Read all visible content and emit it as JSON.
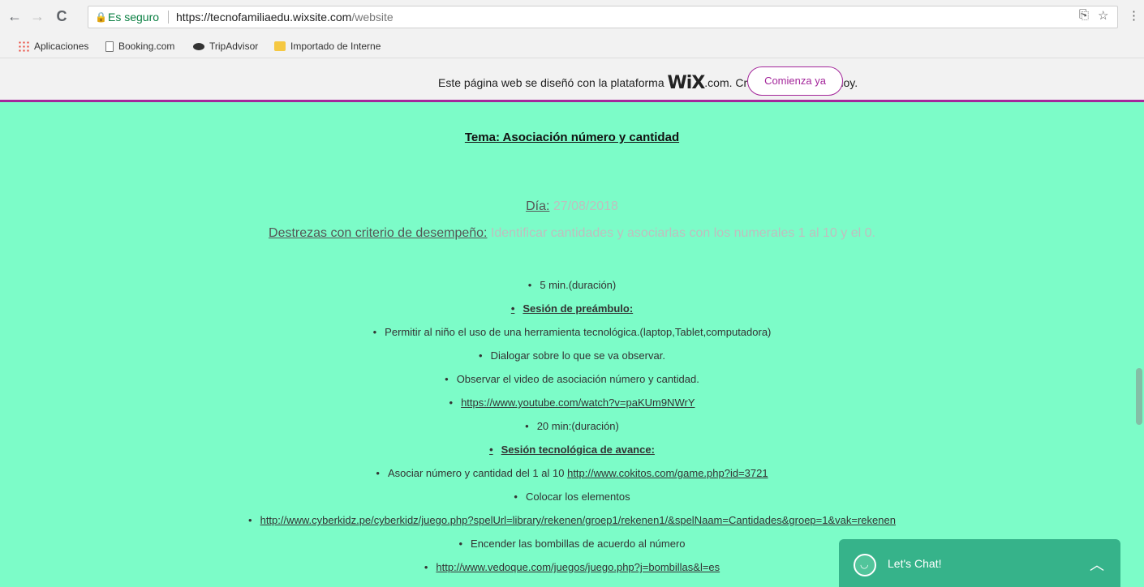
{
  "browser": {
    "back_icon": "←",
    "forward_icon": "→",
    "reload_icon": "C",
    "secure_label": "Es seguro",
    "url_host": "https://tecnofamiliaedu.wixsite.com",
    "url_path": "/website",
    "translate_icon": "⎘",
    "star_icon": "☆",
    "menu_icon": "⋮"
  },
  "bookmarks": [
    {
      "label": "Aplicaciones",
      "icon": "apps-icon"
    },
    {
      "label": "Booking.com",
      "icon": "page-icon"
    },
    {
      "label": "TripAdvisor",
      "icon": "tripadvisor-icon"
    },
    {
      "label": "Importado de Interne",
      "icon": "folder-icon"
    }
  ],
  "wix_banner": {
    "text_before": "Este página web se diseñó con la plataforma ",
    "logo": "WiX",
    "text_after": ".com. Crea tu página web hoy.",
    "button": "Comienza ya"
  },
  "page": {
    "title": "Tema: Asociación número y cantidad",
    "day_label": "Día:",
    "day_value": " 27/08/2018",
    "skills_label": "Destrezas con criterio de desempeño:",
    "skills_value": " Identificar cantidades y asociarlas con los numerales 1 al 10 y el 0.",
    "bullets": [
      {
        "text": "5 min.(duración)"
      },
      {
        "text": "Sesión de preámbulo: "
      },
      {
        "text": "Permitir al niño el uso de una herramienta tecnológica.(laptop,Tablet,computadora)"
      },
      {
        "text": "Dialogar sobre lo que se va observar."
      },
      {
        "text": "Observar el video de asociación número y cantidad."
      },
      {
        "link": "https://www.youtube.com/watch?v=paKUm9NWrY"
      },
      {
        "text": "20 min:(duración)"
      },
      {
        "text": "Sesión tecnológica de avance:"
      },
      {
        "text": "Asociar número y cantidad del 1 al 10 ",
        "link": "http://www.cokitos.com/game.php?id=3721"
      },
      {
        "text": "Colocar los elementos"
      },
      {
        "link": "http://www.cyberkidz.pe/cyberkidz/juego.php?spelUrl=library/rekenen/groep1/rekenen1/&spelNaam=Cantidades&groep=1&vak=rekenen"
      },
      {
        "text": "Encender las bombillas de acuerdo al número"
      },
      {
        "link": "http://www.vedoque.com/juegos/juego.php?j=bombillas&l=es"
      }
    ]
  },
  "chat": {
    "label": "Let's Chat!",
    "chevron": "︿"
  }
}
